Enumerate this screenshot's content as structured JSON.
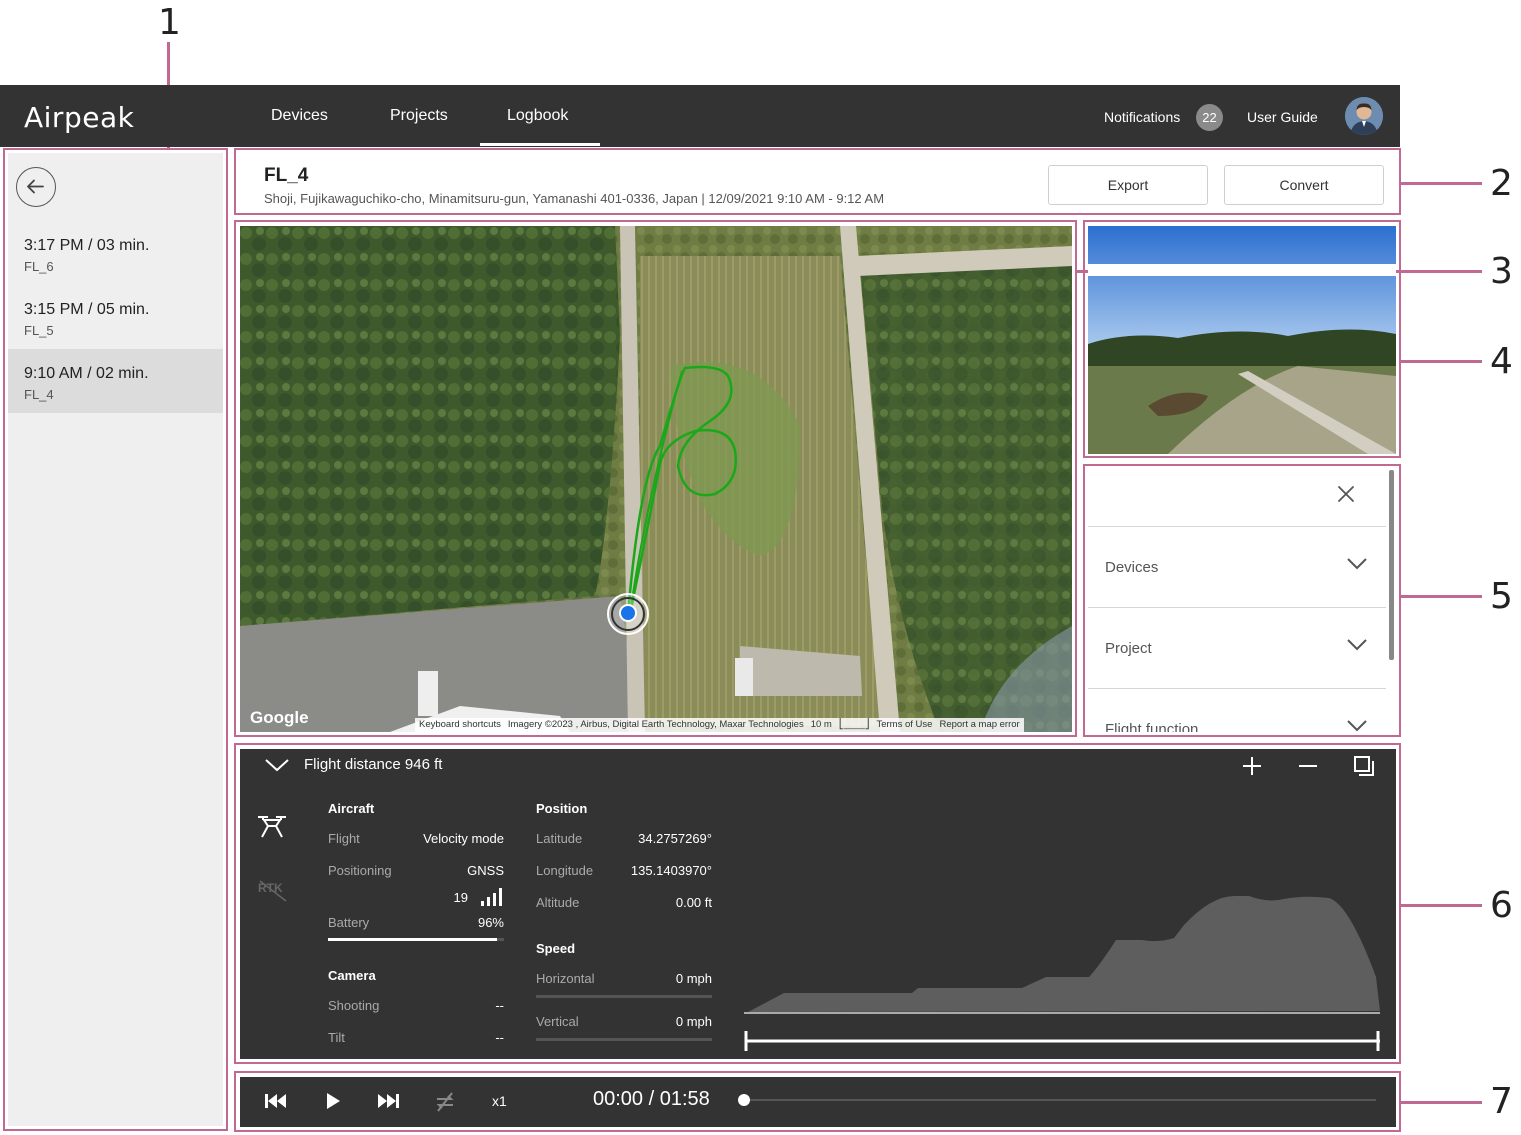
{
  "callouts": [
    "1",
    "2",
    "3",
    "4",
    "5",
    "6",
    "7"
  ],
  "nav": {
    "logo": "Airpeak",
    "items": [
      "Devices",
      "Projects",
      "Logbook"
    ],
    "active": "Logbook",
    "notifications_label": "Notifications",
    "notifications_count": "22",
    "user_guide": "User Guide"
  },
  "sidebar": {
    "items": [
      {
        "time": "3:17 PM / 03 min.",
        "name": "FL_6"
      },
      {
        "time": "3:15 PM / 05 min.",
        "name": "FL_5"
      },
      {
        "time": "9:10 AM / 02 min.",
        "name": "FL_4"
      }
    ],
    "selected_index": 2
  },
  "header": {
    "title": "FL_4",
    "subtitle": "Shoji, Fujikawaguchiko-cho, Minamitsuru-gun, Yamanashi 401-0336, Japan | 12/09/2021 9:10 AM - 9:12 AM",
    "export_label": "Export",
    "convert_label": "Convert"
  },
  "map": {
    "google_logo": "Google",
    "attr_keyboard": "Keyboard shortcuts",
    "attr_imagery": "Imagery ©2023 , Airbus, Digital Earth Technology, Maxar Technologies",
    "attr_scale": "10 m",
    "attr_terms": "Terms of Use",
    "attr_report": "Report a map error",
    "track_color": "#1aa81a",
    "marker_color": "#1a73e8"
  },
  "filter": {
    "rows": [
      "Devices",
      "Project",
      "Flight function"
    ]
  },
  "telemetry": {
    "title": "Flight distance 946 ft",
    "aircraft": {
      "heading": "Aircraft",
      "flight_label": "Flight",
      "flight_value": "Velocity mode",
      "positioning_label": "Positioning",
      "positioning_value": "GNSS",
      "satellites": "19",
      "battery_label": "Battery",
      "battery_value": "96%",
      "battery_fraction": 0.96
    },
    "camera": {
      "heading": "Camera",
      "shooting_label": "Shooting",
      "shooting_value": "--",
      "tilt_label": "Tilt",
      "tilt_value": "--"
    },
    "position": {
      "heading": "Position",
      "latitude_label": "Latitude",
      "latitude_value": "34.2757269°",
      "longitude_label": "Longitude",
      "longitude_value": "135.1403970°",
      "altitude_label": "Altitude",
      "altitude_value": "0.00 ft"
    },
    "speed": {
      "heading": "Speed",
      "horizontal_label": "Horizontal",
      "horizontal_value": "0 mph",
      "vertical_label": "Vertical",
      "vertical_value": "0 mph"
    },
    "rtk_icon_text": "RTK"
  },
  "playback": {
    "speed": "x1",
    "timecode": "00:00 / 01:58",
    "progress_fraction": 0
  }
}
